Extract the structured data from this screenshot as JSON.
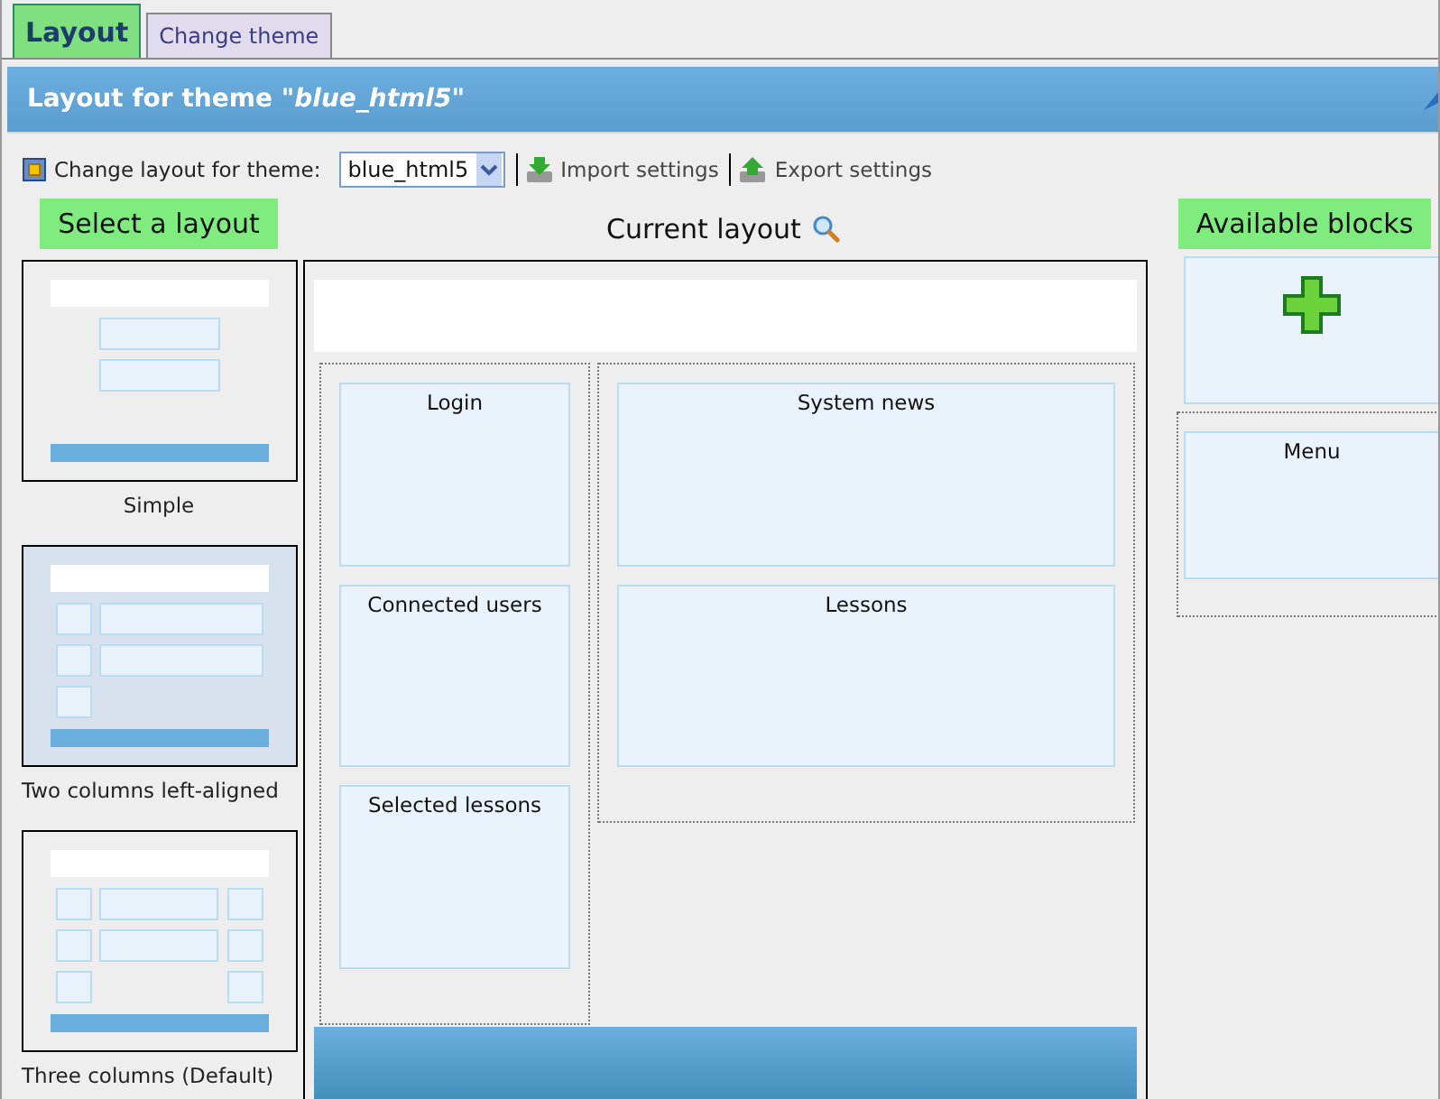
{
  "tabs": [
    {
      "label": "Layout",
      "selected": true
    },
    {
      "label": "Change theme",
      "selected": false
    }
  ],
  "panel": {
    "title": "Layout for theme ",
    "theme_name": "\"blue_html5\""
  },
  "toolbar": {
    "label": "Change layout for theme:",
    "theme_select": {
      "value": "blue_html5"
    },
    "import_link": "Import settings",
    "export_link": "Export settings"
  },
  "layouts": {
    "heading": "Select a layout",
    "items": [
      {
        "kind": "simple",
        "name": "Simple",
        "selected": false
      },
      {
        "kind": "two_left",
        "name": "Two columns left-aligned",
        "selected": true
      },
      {
        "kind": "three",
        "name": "Three columns (Default)",
        "selected": false
      }
    ]
  },
  "current_layout": {
    "heading": "Current layout",
    "columns": [
      {
        "kind": "side",
        "blocks": [
          "Login",
          "Connected users",
          "Selected lessons"
        ]
      },
      {
        "kind": "main",
        "blocks": [
          "System news",
          "Lessons"
        ]
      }
    ]
  },
  "available_blocks": {
    "heading": "Available blocks",
    "blocks": [
      "Menu"
    ]
  }
}
